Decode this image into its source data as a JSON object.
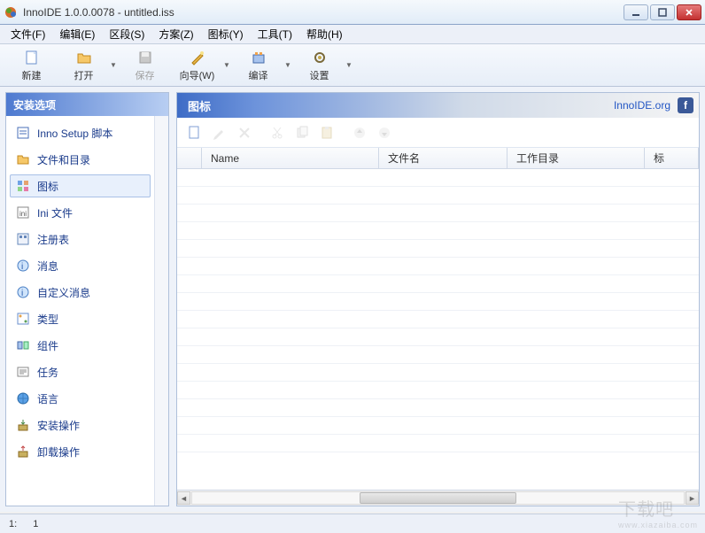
{
  "window": {
    "title": "InnoIDE 1.0.0.0078 - untitled.iss"
  },
  "menu": {
    "file": "文件(F)",
    "edit": "编辑(E)",
    "section": "区段(S)",
    "project": "方案(Z)",
    "icons": "图标(Y)",
    "tools": "工具(T)",
    "help": "帮助(H)"
  },
  "toolbar": {
    "new": "新建",
    "open": "打开",
    "save": "保存",
    "wizard": "向导(W)",
    "compile": "编译",
    "settings": "设置"
  },
  "sidebar": {
    "header": "安装选项",
    "items": [
      {
        "label": "Inno Setup 脚本",
        "icon": "script"
      },
      {
        "label": "文件和目录",
        "icon": "folder"
      },
      {
        "label": "图标",
        "icon": "icons",
        "selected": true
      },
      {
        "label": "Ini 文件",
        "icon": "ini"
      },
      {
        "label": "注册表",
        "icon": "registry"
      },
      {
        "label": "消息",
        "icon": "info"
      },
      {
        "label": "自定义消息",
        "icon": "info"
      },
      {
        "label": "类型",
        "icon": "types"
      },
      {
        "label": "组件",
        "icon": "components"
      },
      {
        "label": "任务",
        "icon": "tasks"
      },
      {
        "label": "语言",
        "icon": "globe"
      },
      {
        "label": "安装操作",
        "icon": "install"
      },
      {
        "label": "卸载操作",
        "icon": "uninstall"
      }
    ]
  },
  "panel": {
    "title": "图标",
    "link": "InnoIDE.org",
    "columns": {
      "name": "Name",
      "filename": "文件名",
      "workdir": "工作目录",
      "icon": "标"
    }
  },
  "status": {
    "line": "1:",
    "col": "1"
  }
}
